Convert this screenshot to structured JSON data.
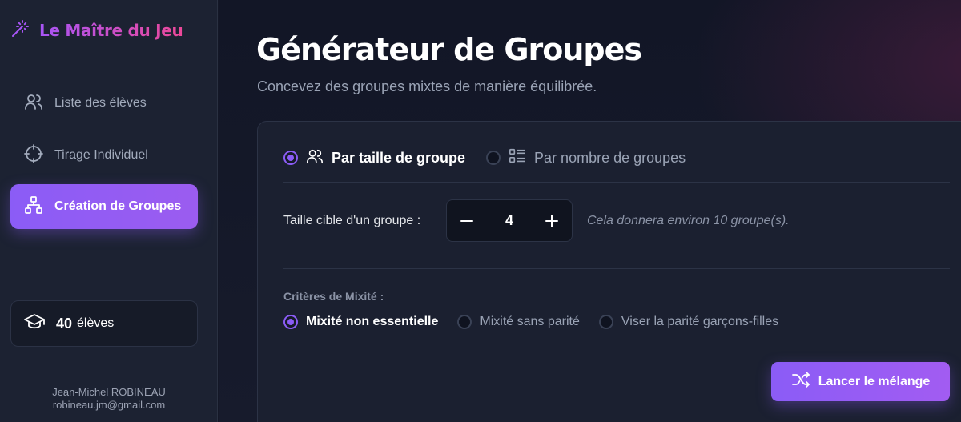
{
  "app": {
    "title": "Le Maître du Jeu"
  },
  "sidebar": {
    "items": [
      {
        "label": "Liste des élèves",
        "icon": "users-icon"
      },
      {
        "label": "Tirage Individuel",
        "icon": "target-icon"
      },
      {
        "label": "Création de Groupes",
        "icon": "hierarchy-icon",
        "active": true
      }
    ],
    "student_count": {
      "value": "40",
      "label": "élèves"
    },
    "author": {
      "name": "Jean-Michel ROBINEAU",
      "email": "robineau.jm@gmail.com"
    }
  },
  "main": {
    "title": "Générateur de Groupes",
    "subtitle": "Concevez des groupes mixtes de manière équilibrée.",
    "modes": [
      {
        "label": "Par taille de groupe",
        "selected": true,
        "icon": "users-icon"
      },
      {
        "label": "Par nombre de groupes",
        "selected": false,
        "icon": "list-icon"
      }
    ],
    "size": {
      "label": "Taille cible d'un groupe :",
      "value": "4",
      "estimate": "Cela donnera environ 10 groupe(s)."
    },
    "criteria": {
      "title": "Critères de Mixité :",
      "options": [
        {
          "label": "Mixité non essentielle",
          "selected": true
        },
        {
          "label": "Mixité sans parité",
          "selected": false
        },
        {
          "label": "Viser la parité garçons-filles",
          "selected": false
        }
      ]
    },
    "launch_label": "Lancer le mélange"
  },
  "colors": {
    "accent": "#8b5cf6",
    "brand_gradient_end": "#ec4899",
    "background": "#141827",
    "sidebar": "#1c2232"
  }
}
